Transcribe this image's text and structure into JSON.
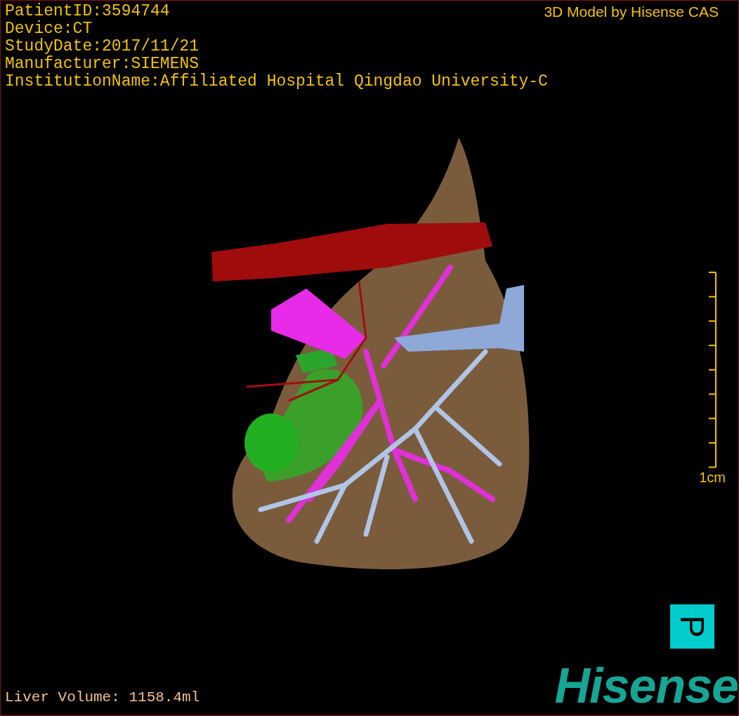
{
  "info_lines": [
    "PatientID:3594744",
    "Device:CT",
    "StudyDate:2017/11/21",
    "Manufacturer:SIEMENS",
    "InstitutionName:Affiliated Hospital Qingdao University-C"
  ],
  "model_credit": "3D Model by Hisense CAS",
  "scale_bar": {
    "label": "1cm"
  },
  "orientation": {
    "label": "P"
  },
  "volume": "Liver Volume: 1158.4ml",
  "logo": "Hisense"
}
